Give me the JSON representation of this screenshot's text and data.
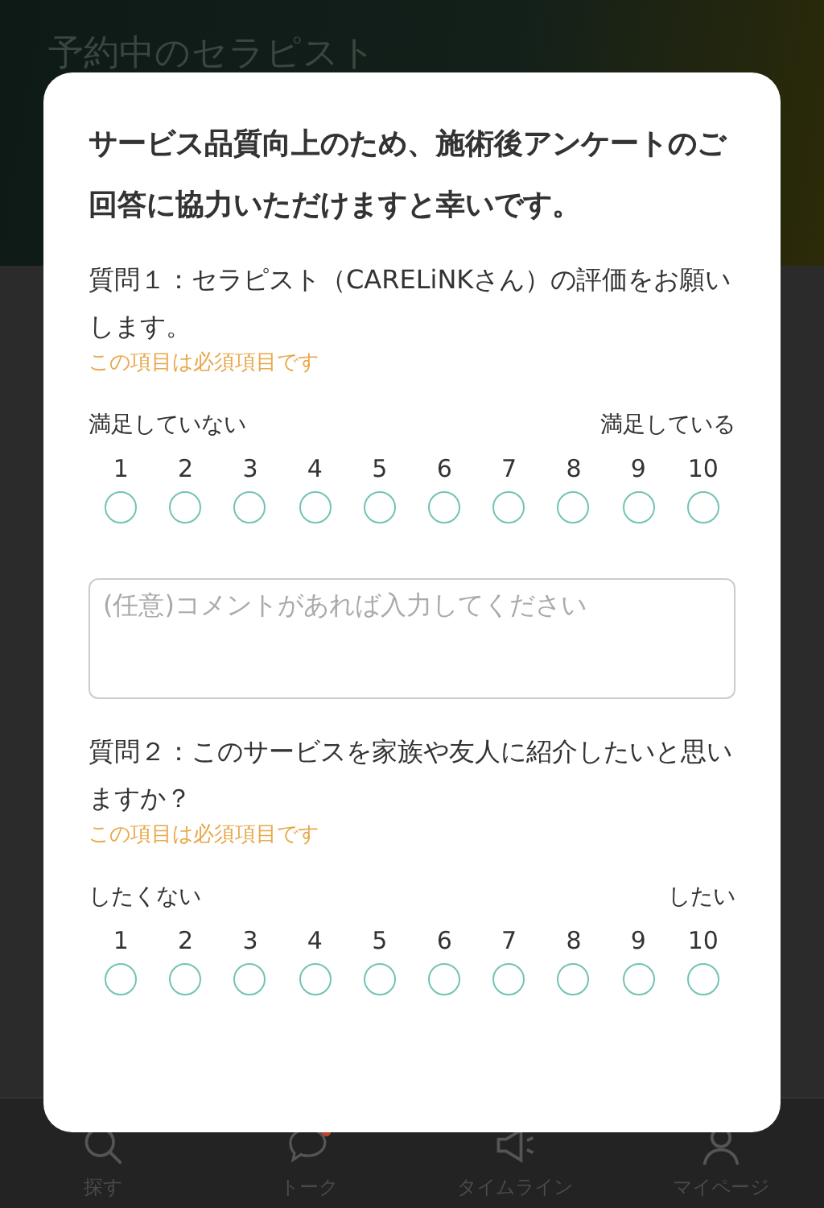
{
  "header": {
    "title": "予約中のセラピスト"
  },
  "dialog": {
    "intro": "サービス品質向上のため、施術後アンケートのご回答に協力いただけますと幸いです。",
    "questions": [
      {
        "text": "質問１：セラピスト（CARELiNKさん）の評価をお願いします。",
        "required_note": "この項目は必須項目です",
        "low_label": "満足していない",
        "high_label": "満足している",
        "options": [
          {
            "label": "1",
            "selected": false
          },
          {
            "label": "2",
            "selected": false
          },
          {
            "label": "3",
            "selected": false
          },
          {
            "label": "4",
            "selected": false
          },
          {
            "label": "5",
            "selected": false
          },
          {
            "label": "6",
            "selected": false
          },
          {
            "label": "7",
            "selected": false
          },
          {
            "label": "8",
            "selected": false
          },
          {
            "label": "9",
            "selected": false
          },
          {
            "label": "10",
            "selected": false
          }
        ],
        "comment": {
          "placeholder": "(任意)コメントがあれば入力してください"
        }
      },
      {
        "text": "質問２：このサービスを家族や友人に紹介したいと思いますか？",
        "required_note": "この項目は必須項目です",
        "low_label": "したくない",
        "high_label": "したい",
        "options": [
          {
            "label": "1",
            "selected": false
          },
          {
            "label": "2",
            "selected": false
          },
          {
            "label": "3",
            "selected": false
          },
          {
            "label": "4",
            "selected": false
          },
          {
            "label": "5",
            "selected": false
          },
          {
            "label": "6",
            "selected": false
          },
          {
            "label": "7",
            "selected": false
          },
          {
            "label": "8",
            "selected": false
          },
          {
            "label": "9",
            "selected": false
          },
          {
            "label": "10",
            "selected": false
          }
        ]
      }
    ]
  },
  "nav": [
    {
      "kind": "search",
      "label": "探す"
    },
    {
      "kind": "talk",
      "label": "トーク"
    },
    {
      "kind": "timeline",
      "label": "タイムライン"
    },
    {
      "kind": "mypage",
      "label": "マイページ"
    }
  ]
}
